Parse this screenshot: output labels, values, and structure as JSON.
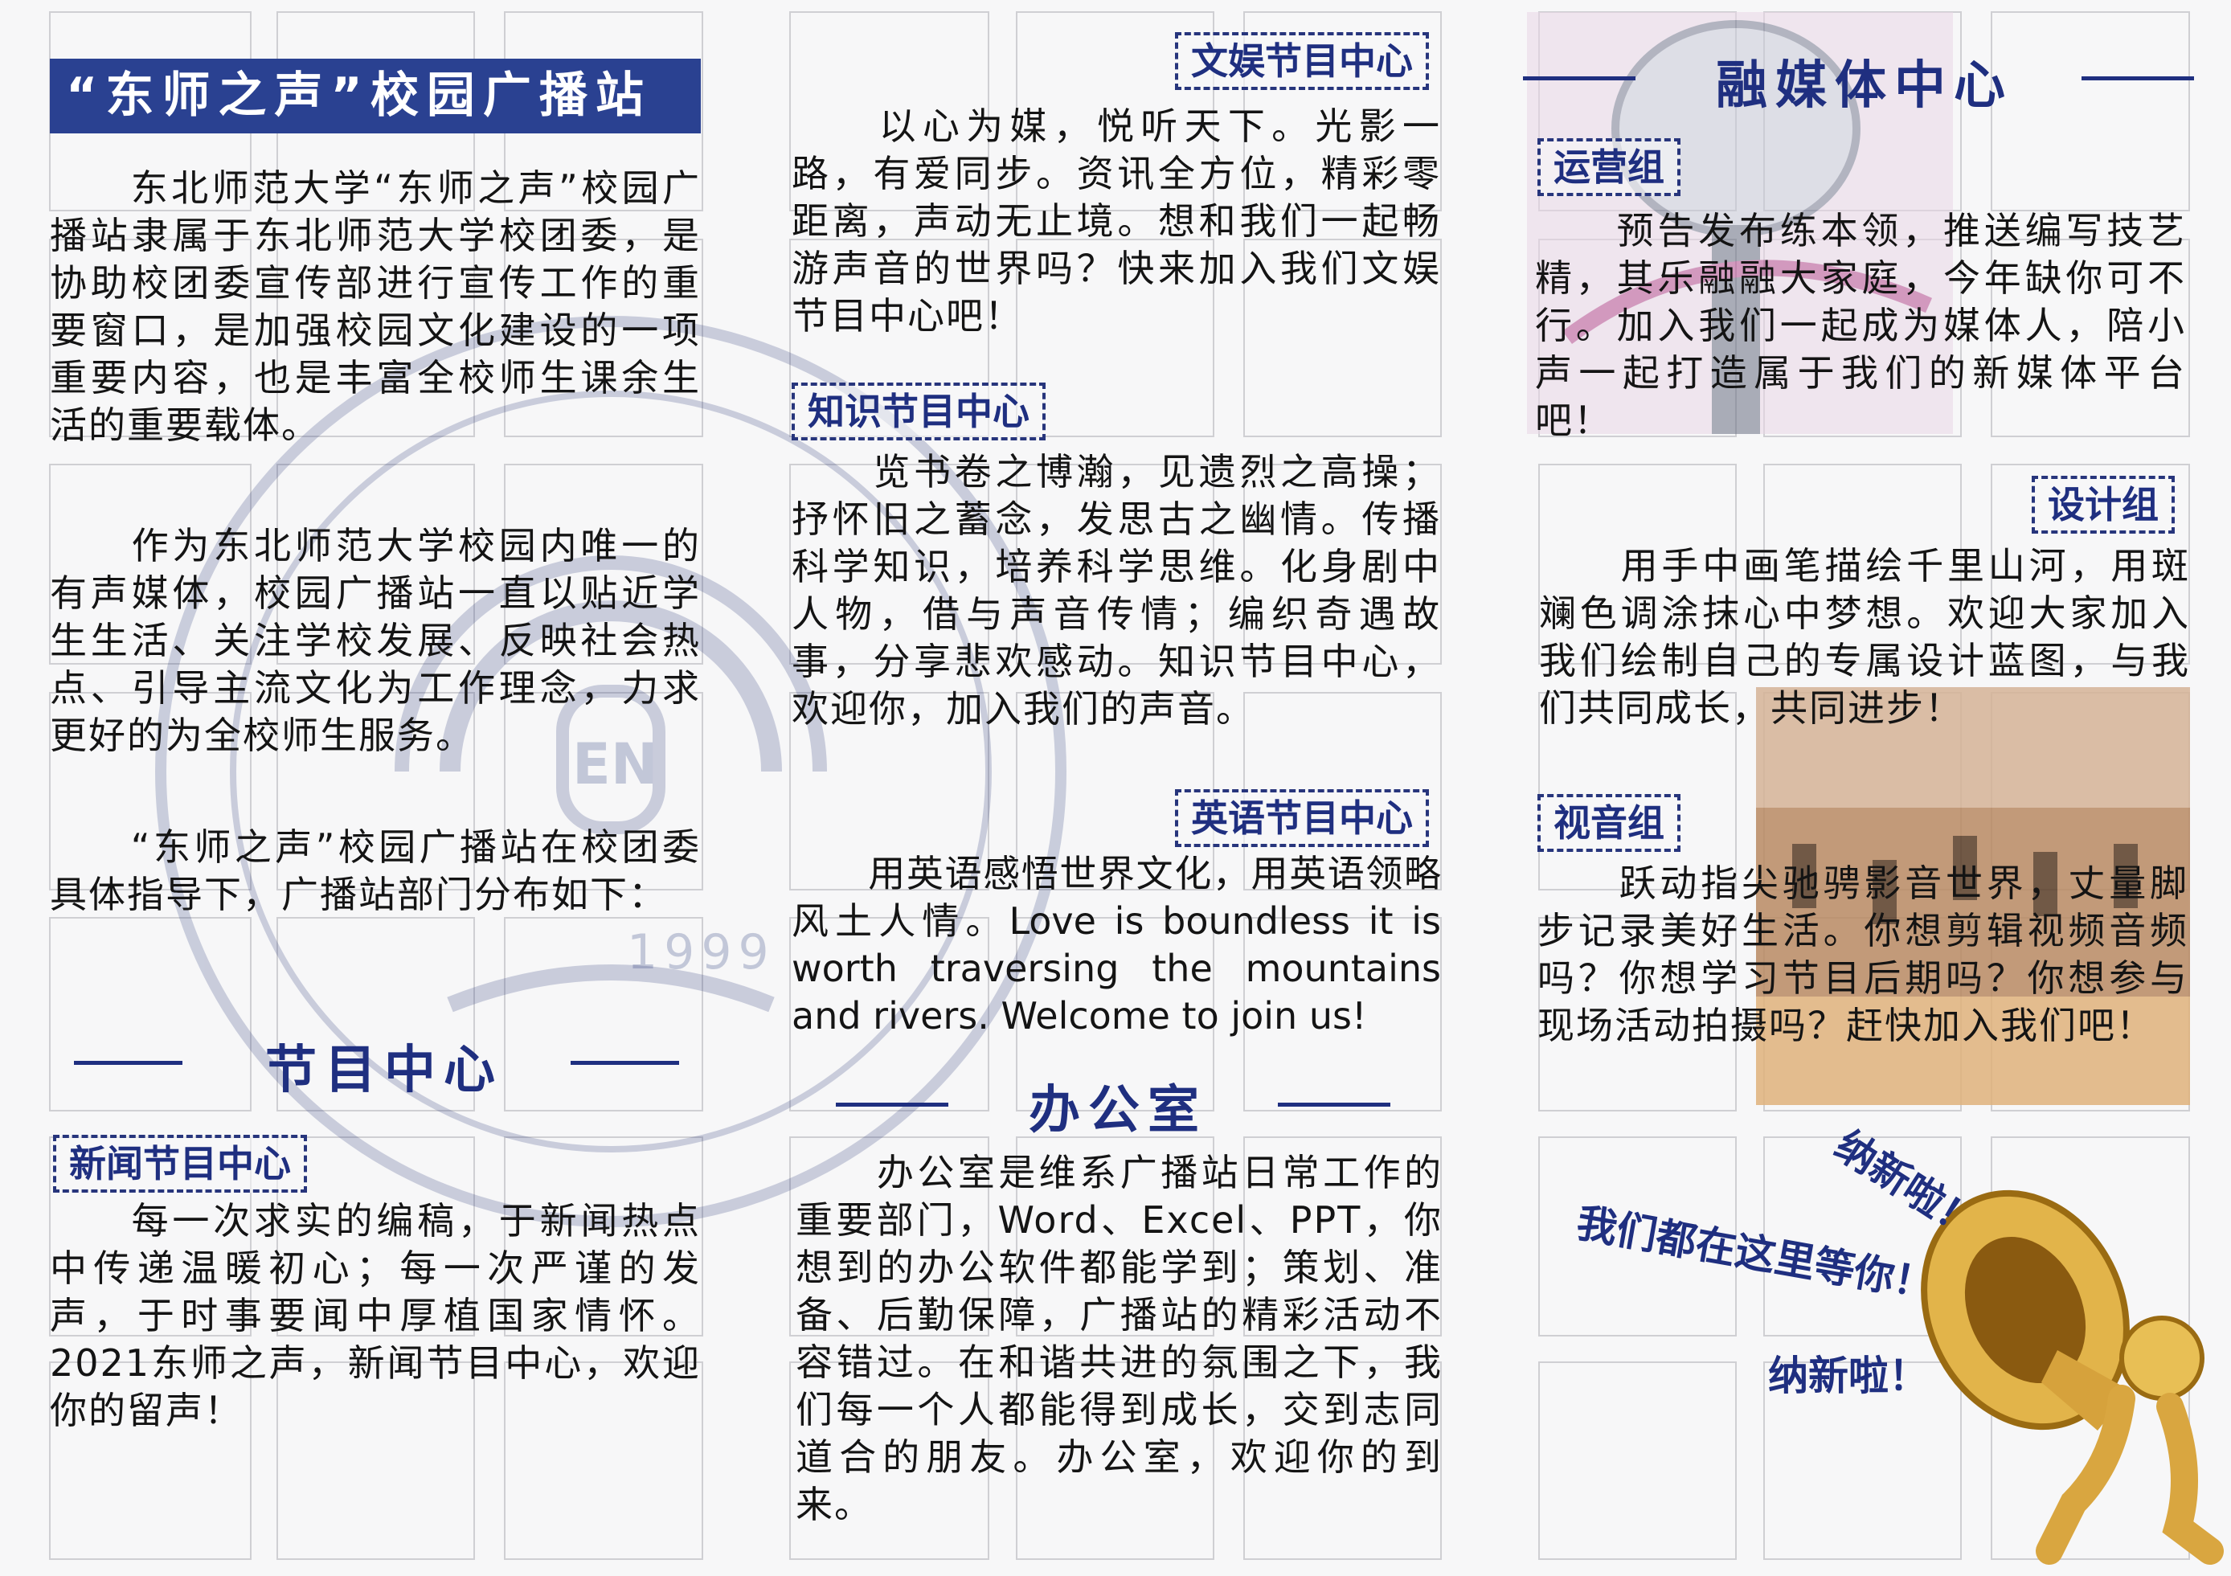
{
  "left": {
    "title": "“东师之声”校园广播站",
    "para1": "　　东北师范大学“东师之声”校园广播站隶属于东北师范大学校团委，是协助校团委宣传部进行宣传工作的重要窗口，是加强校园文化建设的一项重要内容，也是丰富全校师生课余生活的重要载体。",
    "para2": "　　作为东北师范大学校园内唯一的有声媒体，校园广播站一直以贴近学生生活、关注学校发展、反映社会热点、引导主流文化为工作理念，力求更好的为全校师生服务。",
    "para3": "　　“东师之声”校园广播站在校团委具体指导下，广播站部门分布如下：",
    "section_head": "节目中心",
    "news_tag": "新闻节目中心",
    "news_text": "　　每一次求实的编稿，于新闻热点中传递温暖初心；每一次严谨的发声，于时事要闻中厚植国家情怀。2021东师之声，新闻节目中心，欢迎你的留声！"
  },
  "middle": {
    "ent_tag": "文娱节目中心",
    "ent_text": "　　以心为媒，悦听天下。光影一路，有爱同步。资讯全方位，精彩零距离，声动无止境。想和我们一起畅游声音的世界吗？快来加入我们文娱节目中心吧！",
    "know_tag": "知识节目中心",
    "know_text": "　　览书卷之博瀚，见遗烈之高操；抒怀旧之蓄念，发思古之幽情。传播科学知识，培养科学思维。化身剧中人物，借与声音传情；编织奇遇故事，分享悲欢感动。知识节目中心，欢迎你，加入我们的声音。",
    "eng_tag": "英语节目中心",
    "eng_text": "　　用英语感悟世界文化，用英语领略风土人情。Love is boundless it is worth traversing the mountains and rivers. Welcome to join us!",
    "office_head": "办公室",
    "office_text": "　　办公室是维系广播站日常工作的重要部门，Word、Excel、PPT，你想到的办公软件都能学到；策划、准备、后勤保障，广播站的精彩活动不容错过。在和谐共进的氛围之下，我们每一个人都能得到成长，交到志同道合的朋友。办公室，欢迎你的到来。"
  },
  "right": {
    "media_head": "融媒体中心",
    "ops_tag": "运营组",
    "ops_text": "　　预告发布练本领，推送编写技艺精，其乐融融大家庭，今年缺你可不行。加入我们一起成为媒体人，陪小声一起打造属于我们的新媒体平台吧！",
    "design_tag": "设计组",
    "design_text": "　　用手中画笔描绘千里山河，用斑斓色调涂抹心中梦想。欢迎大家加入我们绘制自己的专属设计蓝图，与我们共同成长，共同进步！",
    "av_tag": "视音组",
    "av_text": "　　跃动指尖驰骋影音世界，丈量脚步记录美好生活。你想剪辑视频音频吗？你想学习节目后期吗？你想参与现场活动拍摄吗？赶快加入我们吧！",
    "callout1": "纳新啦！",
    "callout2": "我们都在这里等你！",
    "callout3": "纳新啦！"
  },
  "watermark": {
    "year": "1999",
    "emblem_letters": "EN"
  },
  "colors": {
    "accent": "#1f2f80",
    "title_bar": "#2a4191",
    "grid": "#c9c9cc"
  }
}
